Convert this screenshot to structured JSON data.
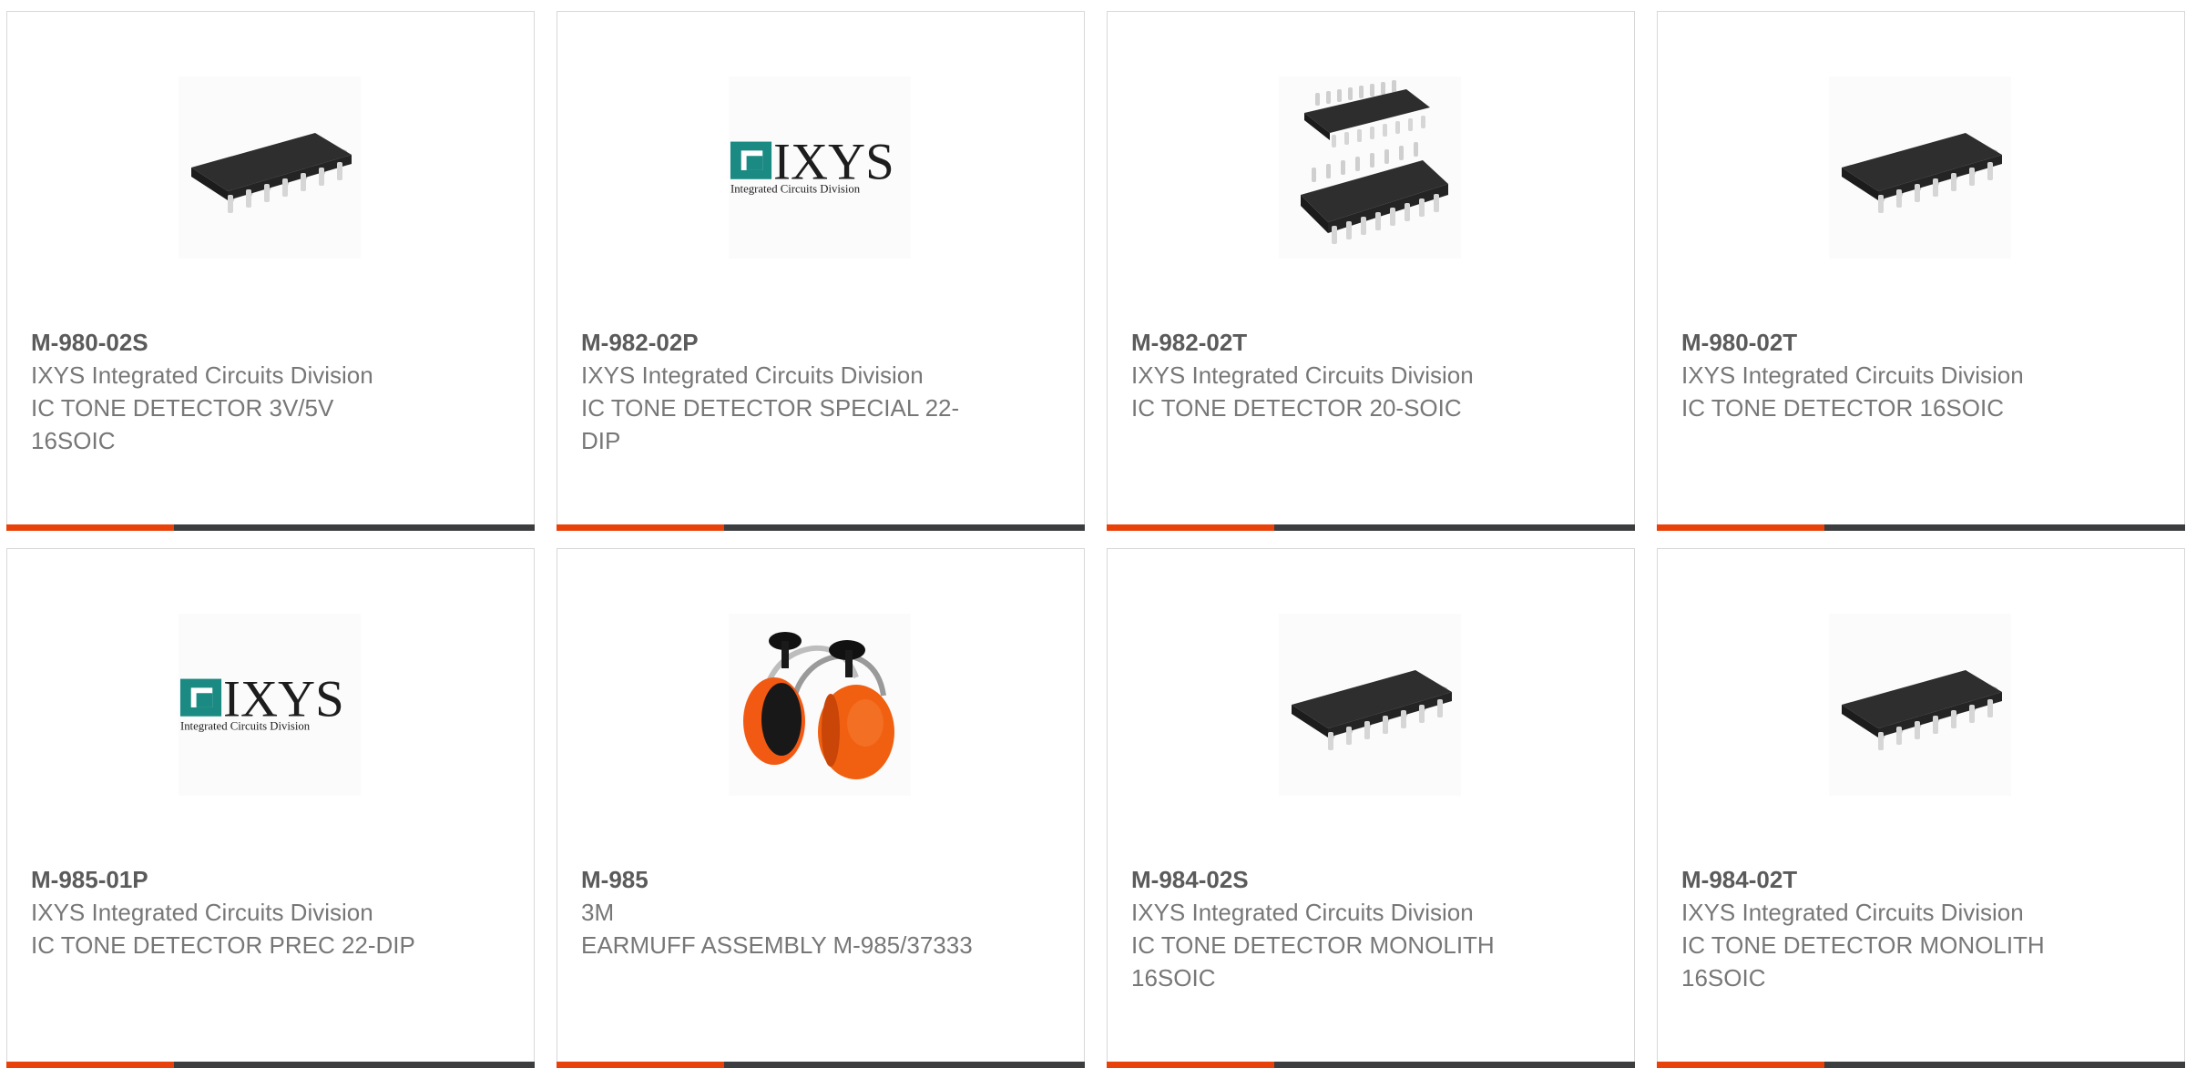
{
  "colors": {
    "accent": "#e8410a",
    "bar": "#3b3d3f",
    "ixys_teal": "#1a8a82"
  },
  "products": [
    {
      "part": "M-980-02S",
      "manufacturer": "IXYS Integrated Circuits Division",
      "description": "IC TONE DETECTOR 3V/5V 16SOIC",
      "image": "soic-chip"
    },
    {
      "part": "M-982-02P",
      "manufacturer": "IXYS Integrated Circuits Division",
      "description": "IC TONE DETECTOR SPECIAL 22-DIP",
      "image": "ixys-logo"
    },
    {
      "part": "M-982-02T",
      "manufacturer": "IXYS Integrated Circuits Division",
      "description": "IC TONE DETECTOR 20-SOIC",
      "image": "soic-chip-pair"
    },
    {
      "part": "M-980-02T",
      "manufacturer": "IXYS Integrated Circuits Division",
      "description": "IC TONE DETECTOR 16SOIC",
      "image": "soic-chip"
    },
    {
      "part": "M-985-01P",
      "manufacturer": "IXYS Integrated Circuits Division",
      "description": "IC TONE DETECTOR PREC 22-DIP",
      "image": "ixys-logo"
    },
    {
      "part": "M-985",
      "manufacturer": "3M",
      "description": "EARMUFF ASSEMBLY M-985/37333",
      "image": "earmuff"
    },
    {
      "part": "M-984-02S",
      "manufacturer": "IXYS Integrated Circuits Division",
      "description": "IC TONE DETECTOR MONOLITH 16SOIC",
      "image": "soic-chip"
    },
    {
      "part": "M-984-02T",
      "manufacturer": "IXYS Integrated Circuits Division",
      "description": "IC TONE DETECTOR MONOLITH 16SOIC",
      "image": "soic-chip"
    }
  ],
  "logo": {
    "wordmark": "IXYS",
    "tagline": "Integrated Circuits Division"
  }
}
